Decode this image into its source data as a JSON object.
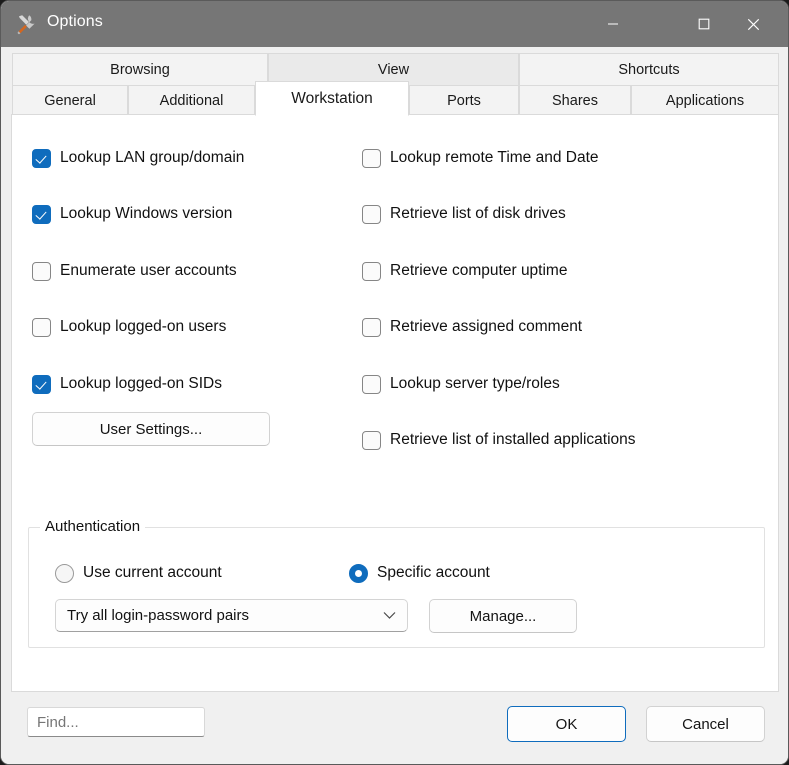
{
  "window": {
    "title": "Options",
    "icon": "tools-icon",
    "controls": {
      "minimize": "Minimize",
      "maximize": "Maximize",
      "close": "Close"
    },
    "titlebar_color": "#767676"
  },
  "tabs": {
    "row1": [
      {
        "label": "Browsing",
        "state": "normal"
      },
      {
        "label": "View",
        "state": "hover"
      },
      {
        "label": "Shortcuts",
        "state": "normal"
      }
    ],
    "row2": [
      {
        "label": "General",
        "state": "normal"
      },
      {
        "label": "Additional",
        "state": "normal"
      },
      {
        "label": "Workstation",
        "state": "active"
      },
      {
        "label": "Ports",
        "state": "normal"
      },
      {
        "label": "Shares",
        "state": "normal"
      },
      {
        "label": "Applications",
        "state": "normal"
      }
    ],
    "active": "Workstation"
  },
  "options": {
    "left_column": [
      {
        "label": "Lookup LAN group/domain",
        "checked": true
      },
      {
        "label": "Lookup Windows version",
        "checked": true
      },
      {
        "label": "Enumerate user accounts",
        "checked": false
      },
      {
        "label": "Lookup logged-on users",
        "checked": false
      },
      {
        "label": "Lookup logged-on SIDs",
        "checked": true
      }
    ],
    "right_column": [
      {
        "label": "Lookup remote Time and Date",
        "checked": false
      },
      {
        "label": "Retrieve list of disk drives",
        "checked": false
      },
      {
        "label": "Retrieve computer uptime",
        "checked": false
      },
      {
        "label": "Retrieve assigned comment",
        "checked": false
      },
      {
        "label": "Lookup server type/roles",
        "checked": false
      },
      {
        "label": "Retrieve list of installed applications",
        "checked": false
      }
    ],
    "user_settings_button": "User Settings..."
  },
  "authentication": {
    "group_title": "Authentication",
    "radios": [
      {
        "label": "Use current account",
        "selected": false
      },
      {
        "label": "Specific account",
        "selected": true
      }
    ],
    "combo_value": "Try all login-password pairs",
    "manage_button": "Manage..."
  },
  "footer": {
    "find_placeholder": "Find...",
    "ok_button": "OK",
    "cancel_button": "Cancel"
  },
  "colors": {
    "accent": "#0f6cbd",
    "titlebar": "#767676",
    "panel": "#ffffff",
    "chrome": "#f0f0f0"
  }
}
